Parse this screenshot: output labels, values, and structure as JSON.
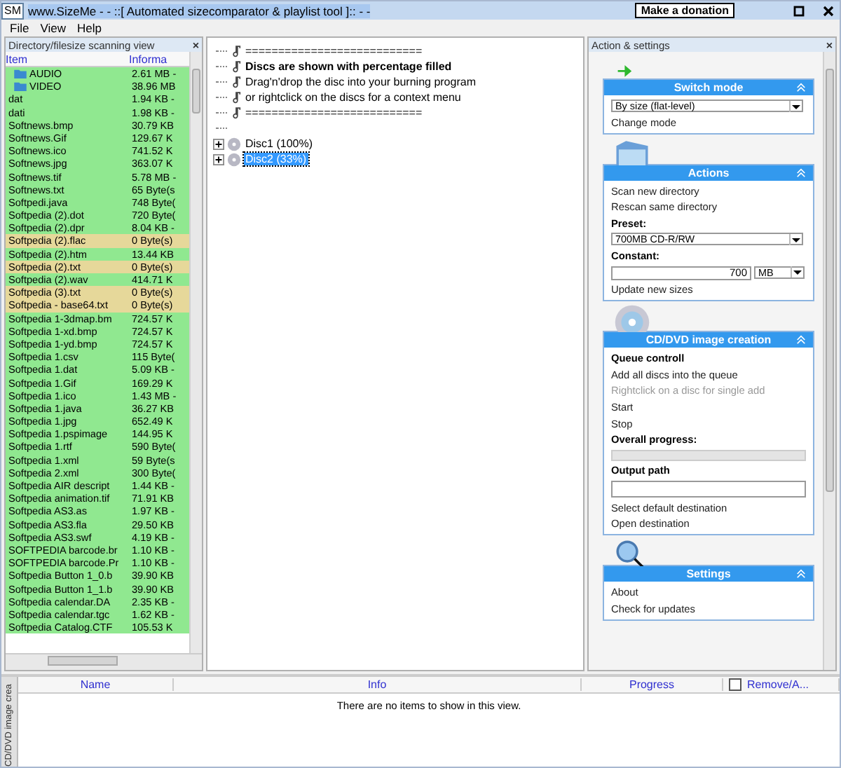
{
  "window": {
    "app_icon": "SM",
    "title": "www.SizeMe - - ::[ Automated sizecomparator & playlist tool ]:: - -",
    "donate_button": "Make a donation"
  },
  "menu": [
    "File",
    "View",
    "Help"
  ],
  "directory_panel": {
    "title": "Directory/filesize scanning view",
    "close": "×",
    "columns": [
      "Item",
      "Informa"
    ],
    "rows": [
      {
        "kind": "folder",
        "name": "AUDIO",
        "info": "2.61 MB -",
        "color": "#90e890"
      },
      {
        "kind": "folder",
        "name": "VIDEO",
        "info": "38.96 MB",
        "color": "#90e890"
      },
      {
        "kind": "file",
        "name": "dat",
        "info": "1.94 KB -",
        "color": "#90e890"
      },
      {
        "kind": "file",
        "name": "dati",
        "info": "1.98 KB -",
        "color": "#90e890"
      },
      {
        "kind": "file",
        "name": "Softnews.bmp",
        "info": "30.79 KB",
        "color": "#90e890"
      },
      {
        "kind": "file",
        "name": "Softnews.Gif",
        "info": "129.67 K",
        "color": "#90e890"
      },
      {
        "kind": "file",
        "name": "Softnews.ico",
        "info": "741.52 K",
        "color": "#90e890"
      },
      {
        "kind": "file",
        "name": "Softnews.jpg",
        "info": "363.07 K",
        "color": "#90e890"
      },
      {
        "kind": "file",
        "name": "Softnews.tif",
        "info": "5.78 MB -",
        "color": "#90e890"
      },
      {
        "kind": "file",
        "name": "Softnews.txt",
        "info": "65 Byte(s",
        "color": "#90e890"
      },
      {
        "kind": "file",
        "name": "Softpedi.java",
        "info": "748 Byte(",
        "color": "#90e890"
      },
      {
        "kind": "file",
        "name": "Softpedia (2).dot",
        "info": "720 Byte(",
        "color": "#90e890"
      },
      {
        "kind": "file",
        "name": "Softpedia (2).dpr",
        "info": "8.04 KB -",
        "color": "#90e890"
      },
      {
        "kind": "file",
        "name": "Softpedia (2).flac",
        "info": "0 Byte(s)",
        "color": "#e6d89a"
      },
      {
        "kind": "file",
        "name": "Softpedia (2).htm",
        "info": "13.44 KB",
        "color": "#90e890"
      },
      {
        "kind": "file",
        "name": "Softpedia (2).txt",
        "info": "0 Byte(s)",
        "color": "#e6d89a"
      },
      {
        "kind": "file",
        "name": "Softpedia (2).wav",
        "info": "414.71 K",
        "color": "#90e890"
      },
      {
        "kind": "file",
        "name": "Softpedia (3).txt",
        "info": "0 Byte(s)",
        "color": "#e6d89a"
      },
      {
        "kind": "file",
        "name": "Softpedia - base64.txt",
        "info": "0 Byte(s)",
        "color": "#e6d89a"
      },
      {
        "kind": "file",
        "name": "Softpedia 1-3dmap.bm",
        "info": "724.57 K",
        "color": "#90e890"
      },
      {
        "kind": "file",
        "name": "Softpedia 1-xd.bmp",
        "info": "724.57 K",
        "color": "#90e890"
      },
      {
        "kind": "file",
        "name": "Softpedia 1-yd.bmp",
        "info": "724.57 K",
        "color": "#90e890"
      },
      {
        "kind": "file",
        "name": "Softpedia 1.csv",
        "info": "115 Byte(",
        "color": "#90e890"
      },
      {
        "kind": "file",
        "name": "Softpedia 1.dat",
        "info": "5.09 KB -",
        "color": "#90e890"
      },
      {
        "kind": "file",
        "name": "Softpedia 1.Gif",
        "info": "169.29 K",
        "color": "#90e890"
      },
      {
        "kind": "file",
        "name": "Softpedia 1.ico",
        "info": "1.43 MB -",
        "color": "#90e890"
      },
      {
        "kind": "file",
        "name": "Softpedia 1.java",
        "info": "36.27 KB",
        "color": "#90e890"
      },
      {
        "kind": "file",
        "name": "Softpedia 1.jpg",
        "info": "652.49 K",
        "color": "#90e890"
      },
      {
        "kind": "file",
        "name": "Softpedia 1.pspimage",
        "info": "144.95 K",
        "color": "#90e890"
      },
      {
        "kind": "file",
        "name": "Softpedia 1.rtf",
        "info": "590 Byte(",
        "color": "#90e890"
      },
      {
        "kind": "file",
        "name": "Softpedia 1.xml",
        "info": "59 Byte(s",
        "color": "#90e890"
      },
      {
        "kind": "file",
        "name": "Softpedia 2.xml",
        "info": "300 Byte(",
        "color": "#90e890"
      },
      {
        "kind": "file",
        "name": "Softpedia AIR descript",
        "info": "1.44 KB -",
        "color": "#90e890"
      },
      {
        "kind": "file",
        "name": "Softpedia animation.tif",
        "info": "71.91 KB",
        "color": "#90e890"
      },
      {
        "kind": "file",
        "name": "Softpedia AS3.as",
        "info": "1.97 KB -",
        "color": "#90e890"
      },
      {
        "kind": "file",
        "name": "Softpedia AS3.fla",
        "info": "29.50 KB",
        "color": "#90e890"
      },
      {
        "kind": "file",
        "name": "Softpedia AS3.swf",
        "info": "4.19 KB -",
        "color": "#90e890"
      },
      {
        "kind": "file",
        "name": "SOFTPEDIA barcode.br",
        "info": "1.10 KB -",
        "color": "#90e890"
      },
      {
        "kind": "file",
        "name": "SOFTPEDIA barcode.Pr",
        "info": "1.10 KB -",
        "color": "#90e890"
      },
      {
        "kind": "file",
        "name": "Softpedia Button 1_0.b",
        "info": "39.90 KB",
        "color": "#90e890"
      },
      {
        "kind": "file",
        "name": "Softpedia Button 1_1.b",
        "info": "39.90 KB",
        "color": "#90e890"
      },
      {
        "kind": "file",
        "name": "Softpedia calendar.DA",
        "info": "2.35 KB -",
        "color": "#90e890"
      },
      {
        "kind": "file",
        "name": "Softpedia calendar.tgc",
        "info": "1.62 KB -",
        "color": "#90e890"
      },
      {
        "kind": "file",
        "name": "Softpedia Catalog.CTF",
        "info": "105.53 K",
        "color": "#90e890"
      }
    ]
  },
  "disc_tree": {
    "info_lines": [
      {
        "text": "===========================",
        "bold": false
      },
      {
        "text": "Discs are shown with percentage filled",
        "bold": true
      },
      {
        "text": "Drag'n'drop the disc into your burning program",
        "bold": false
      },
      {
        "text": "or rightclick on the discs for a context menu",
        "bold": false
      },
      {
        "text": "===========================",
        "bold": false
      }
    ],
    "discs": [
      {
        "label": "Disc1 (100%)",
        "selected": false,
        "expanded": false
      },
      {
        "label": "Disc2 (33%)",
        "selected": true,
        "expanded": false
      }
    ]
  },
  "settings_panel": {
    "title": "Action & settings",
    "close": "×",
    "sections": [
      {
        "title": "Switch mode",
        "items": [
          {
            "kind": "select",
            "value": "By size (flat-level)"
          },
          {
            "kind": "link",
            "text": "Change mode"
          }
        ]
      },
      {
        "title": "Actions",
        "items": [
          {
            "kind": "link",
            "text": "Scan new directory"
          },
          {
            "kind": "link",
            "text": "Rescan same directory"
          },
          {
            "kind": "label",
            "text": "Preset:"
          },
          {
            "kind": "select",
            "value": "700MB CD-R/RW"
          },
          {
            "kind": "label",
            "text": "Constant:"
          },
          {
            "kind": "number",
            "value": "700",
            "unit": "MB"
          },
          {
            "kind": "link",
            "text": "Update new sizes"
          }
        ]
      },
      {
        "title": "CD/DVD image creation",
        "items": [
          {
            "kind": "label",
            "text": "Queue controll"
          },
          {
            "kind": "link",
            "text": "Add all discs into the queue"
          },
          {
            "kind": "hint",
            "text": "Rightclick on a disc for single add"
          },
          {
            "kind": "link",
            "text": "Start"
          },
          {
            "kind": "link",
            "text": "Stop"
          },
          {
            "kind": "label",
            "text": "Overall progress:"
          },
          {
            "kind": "progress",
            "level": 0
          },
          {
            "kind": "label",
            "text": "Output path"
          },
          {
            "kind": "input"
          },
          {
            "kind": "link",
            "text": "Select default destination"
          },
          {
            "kind": "link",
            "text": "Open destination"
          }
        ]
      },
      {
        "title": "Settings",
        "items": [
          {
            "kind": "link",
            "text": "About"
          },
          {
            "kind": "link",
            "text": "Check for updates"
          }
        ]
      }
    ]
  },
  "queue_panel": {
    "side_tab": "CD/DVD image crea",
    "columns": [
      "Name",
      "Info",
      "Progress",
      "Remove/A..."
    ],
    "remove_checked": false,
    "empty_message": "There are no items to show in this view."
  }
}
